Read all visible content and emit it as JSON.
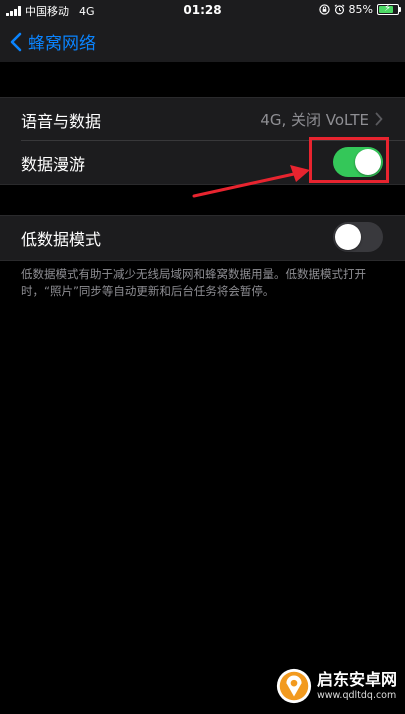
{
  "status_bar": {
    "carrier": "中国移动",
    "network": "4G",
    "time": "01:28",
    "battery_percent": "85%",
    "battery_level": 0.85,
    "battery_color": "#4cd964"
  },
  "nav": {
    "back_label": "蜂窝网络",
    "accent_color": "#0a84ff"
  },
  "settings": {
    "voice_data": {
      "label": "语音与数据",
      "value": "4G, 关闭 VoLTE"
    },
    "data_roaming": {
      "label": "数据漫游",
      "state": "on"
    },
    "low_data_mode": {
      "label": "低数据模式",
      "state": "off",
      "footnote": "低数据模式有助于减少无线局域网和蜂窝数据用量。低数据模式打开时，“照片”同步等自动更新和后台任务将会暂停。"
    }
  },
  "colors": {
    "toggle_on": "#34c759",
    "toggle_off": "#39393d",
    "annotation_red": "#e8242f"
  },
  "icons": {
    "back": "chevron-left-icon",
    "row_disclosure": "chevron-right-icon",
    "status_lock": "orientation-lock-icon",
    "status_alarm": "alarm-icon",
    "battery": "battery-charging-icon"
  },
  "watermark": {
    "title": "启东安卓网",
    "url": "www.qdltdq.com"
  }
}
